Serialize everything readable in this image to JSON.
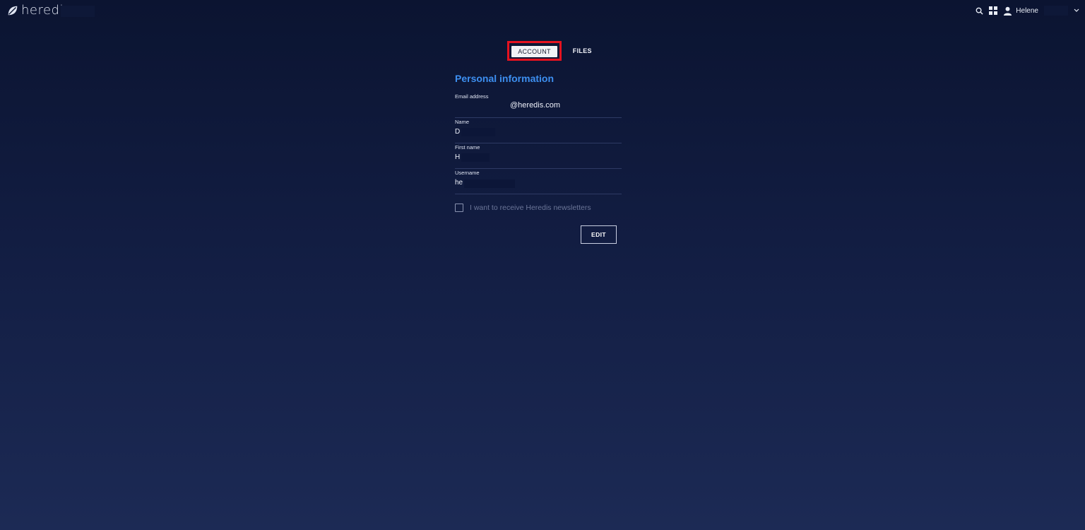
{
  "brand": {
    "logo_text": "heredis"
  },
  "header": {
    "user_name": "Helene",
    "icons": [
      "search-icon",
      "grid-icon",
      "user-icon",
      "chevron-down-icon"
    ]
  },
  "tabs": [
    {
      "label": "ACCOUNT",
      "active": true
    },
    {
      "label": "FILES",
      "active": false
    }
  ],
  "personal": {
    "title": "Personal information",
    "fields": [
      {
        "label": "Email address",
        "value": "@heredis.com"
      },
      {
        "label": "Name",
        "value": "D"
      },
      {
        "label": "First name",
        "value": "H"
      },
      {
        "label": "Username",
        "value": "he"
      }
    ],
    "newsletter_label": "I want to receive Heredis newsletters",
    "newsletter_checked": false
  },
  "actions": {
    "edit_label": "EDIT"
  },
  "colors": {
    "accent": "#3d8ff0",
    "highlight": "#e5121f",
    "background_top": "#0b1431",
    "background_bottom": "#1c2a55"
  }
}
